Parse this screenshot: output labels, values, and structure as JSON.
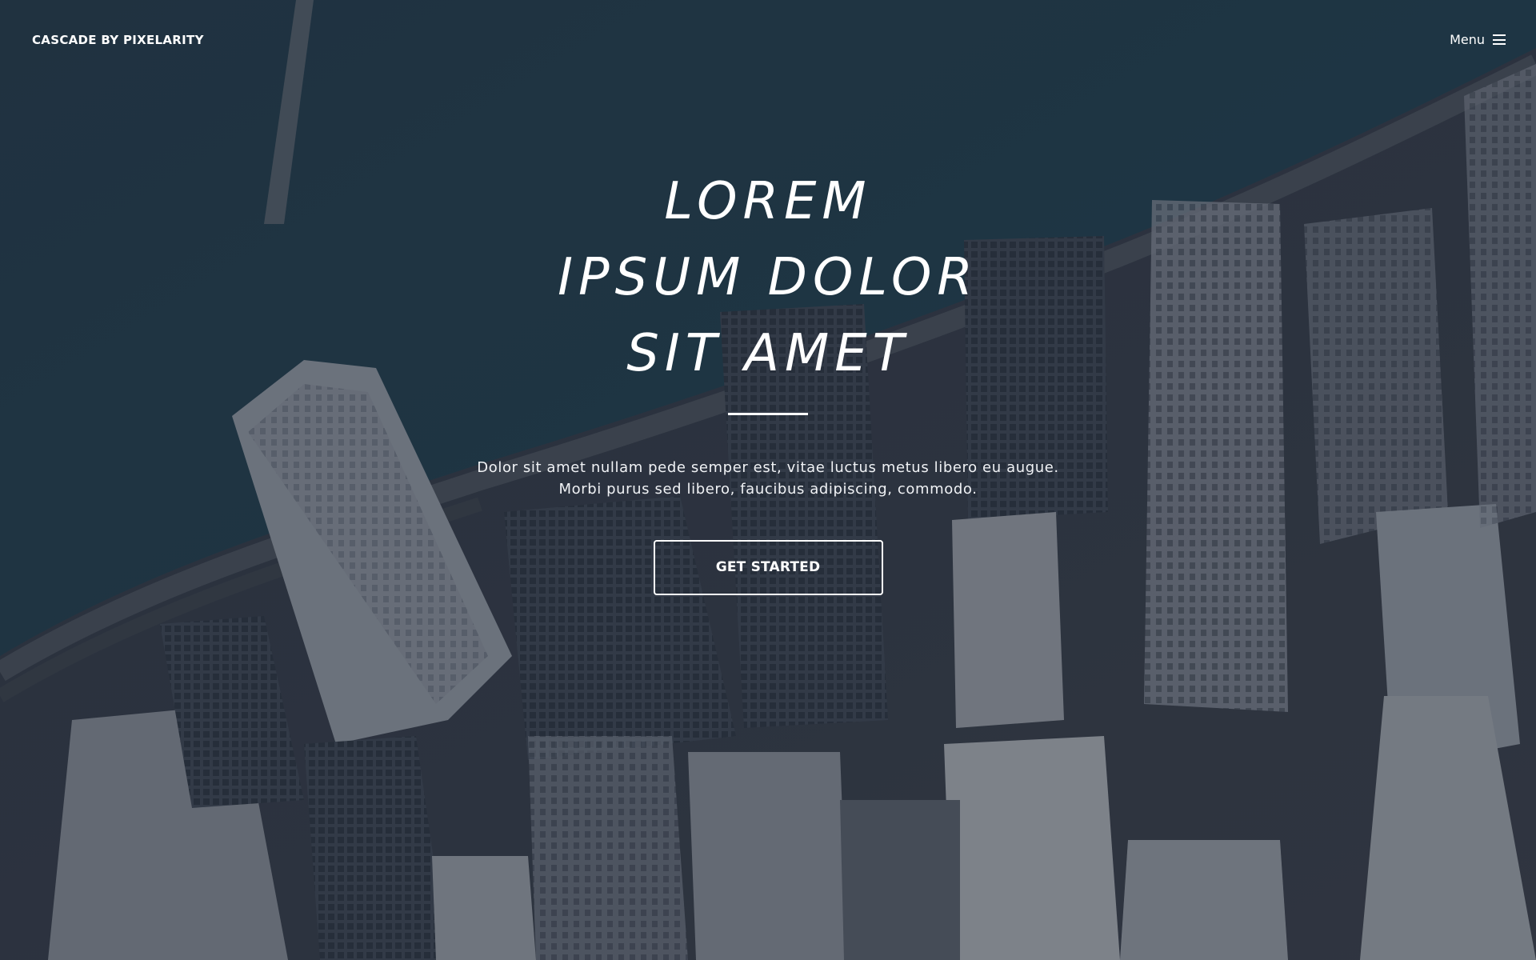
{
  "header": {
    "brand": "CASCADE BY PIXELARITY",
    "menu_label": "Menu",
    "menu_icon": "hamburger-icon"
  },
  "hero": {
    "title_lines": [
      "LOREM",
      "IPSUM DOLOR",
      "SIT AMET"
    ],
    "description_lines": [
      "Dolor sit amet nullam pede semper est, vitae luctus metus libero eu augue.",
      "Morbi purus sed libero, faucibus adipiscing, commodo."
    ],
    "cta_label": "GET STARTED"
  },
  "colors": {
    "text": "#ffffff",
    "overlay": "#202a38",
    "water": "#1f3a48"
  }
}
